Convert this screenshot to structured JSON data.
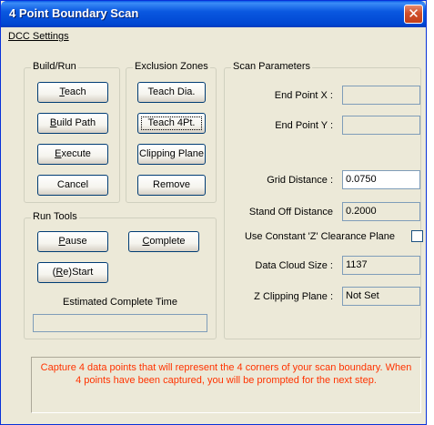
{
  "window": {
    "title": "4 Point Boundary Scan",
    "close_glyph": "✕"
  },
  "menu": {
    "item": "DCC Settings"
  },
  "build_run": {
    "label": "Build/Run",
    "teach": {
      "ul": "T",
      "rest": "each"
    },
    "build_path": {
      "ul": "B",
      "rest": "uild Path"
    },
    "execute": {
      "ul": "E",
      "rest": "xecute"
    },
    "cancel": "Cancel"
  },
  "exclusion": {
    "label": "Exclusion Zones",
    "teach_dia": "Teach Dia.",
    "teach_4pt": "Teach 4Pt.",
    "clipping_plane": "Clipping Plane",
    "remove": "Remove"
  },
  "run_tools": {
    "label": "Run Tools",
    "pause": {
      "ul": "P",
      "rest": "ause"
    },
    "complete": {
      "ul": "C",
      "rest": "omplete"
    },
    "restart": {
      "pre": "(",
      "ul": "R",
      "rest": "e)Start"
    },
    "estimated_label": "Estimated Complete Time",
    "estimated_value": ""
  },
  "scan": {
    "label": "Scan Parameters",
    "end_x_label": "End Point X :",
    "end_x_value": "",
    "end_y_label": "End Point Y :",
    "end_y_value": "",
    "grid_label": "Grid Distance :",
    "grid_value": "0.0750",
    "standoff_label": "Stand Off Distance",
    "standoff_value": "0.2000",
    "constant_z_label": "Use Constant 'Z' Clearance Plane",
    "constant_z_checked": false,
    "cloud_label": "Data Cloud Size :",
    "cloud_value": "1137",
    "zclip_label": "Z Clipping Plane :",
    "zclip_value": "Not Set"
  },
  "info": {
    "message": "Capture 4 data points that will represent the 4 corners of your scan boundary.  When 4 points have been captured, you will be prompted for the next step."
  },
  "colors": {
    "title_bar": "#0054e3",
    "dialog_bg": "#ece9d8",
    "info_text": "#ff3300",
    "close_button": "#d0502b"
  }
}
